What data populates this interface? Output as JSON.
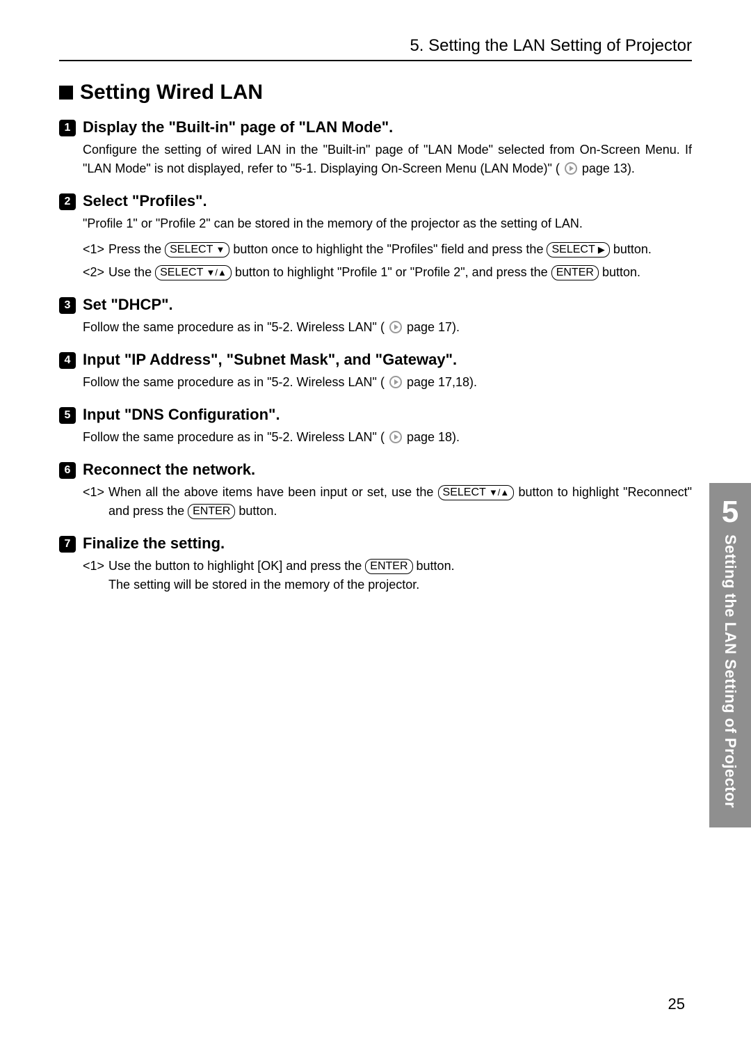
{
  "header": {
    "running": "5. Setting the LAN Setting of Projector"
  },
  "section": {
    "title": "Setting Wired LAN"
  },
  "tab": {
    "chapter": "5",
    "label": "Setting the LAN Setting of Projector"
  },
  "page_number": "25",
  "buttons": {
    "select_down": "SELECT",
    "select_right": "SELECT",
    "select_updown": "SELECT",
    "enter": "ENTER"
  },
  "steps": [
    {
      "num": "1",
      "title": "Display the \"Built-in\" page of \"LAN Mode\".",
      "body_before_ref": "Configure the setting of wired LAN in the \"Built-in\" page of \"LAN Mode\" selected from On-Screen Menu.  If \"LAN Mode\" is not displayed, refer to \"5-1. Displaying On-Screen Menu (LAN Mode)\" ( ",
      "body_after_ref": " page 13)."
    },
    {
      "num": "2",
      "title": "Select \"Profiles\".",
      "intro": "\"Profile 1\" or \"Profile 2\" can be stored in the memory of the projector as the setting of LAN.",
      "subs": [
        {
          "marker": "<1>",
          "pre": "Press the ",
          "mid": " button once to highlight the \"Profiles\" field and press the ",
          "post": " button."
        },
        {
          "marker": "<2>",
          "pre": "Use the ",
          "mid": " button to highlight \"Profile 1\" or \"Profile 2\", and press the ",
          "post": " button."
        }
      ]
    },
    {
      "num": "3",
      "title": "Set \"DHCP\".",
      "body_before_ref": "Follow the same procedure as in \"5-2. Wireless LAN\" ( ",
      "body_after_ref": " page 17)."
    },
    {
      "num": "4",
      "title": "Input \"IP Address\", \"Subnet Mask\", and \"Gateway\".",
      "body_before_ref": "Follow the same procedure as in \"5-2. Wireless LAN\" ( ",
      "body_after_ref": " page 17,18)."
    },
    {
      "num": "5",
      "title": "Input \"DNS Configuration\".",
      "body_before_ref": "Follow the same procedure as in \"5-2. Wireless LAN\" ( ",
      "body_after_ref": " page 18)."
    },
    {
      "num": "6",
      "title": "Reconnect the network.",
      "subs": [
        {
          "marker": "<1>",
          "pre": "When all the above items have been input or set, use the ",
          "mid": " button to highlight \"Reconnect\" and press the ",
          "post": " button."
        }
      ]
    },
    {
      "num": "7",
      "title": "Finalize the setting.",
      "subs": [
        {
          "marker": "<1>",
          "pre": "Use the  button to highlight [OK] and press the ",
          "post": " button.",
          "trailing": "The setting will be stored in the memory of the projector."
        }
      ]
    }
  ]
}
